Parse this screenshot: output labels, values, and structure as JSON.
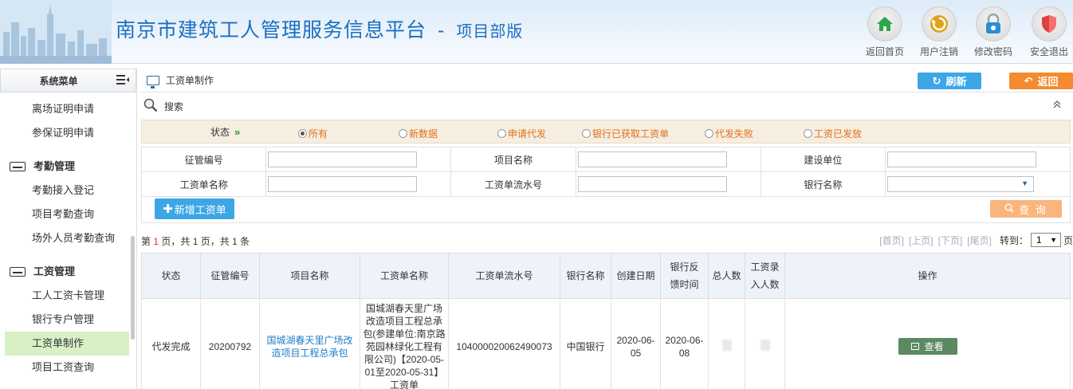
{
  "header": {
    "title": "南京市建筑工人管理服务信息平台",
    "separator": "-",
    "subtitle": "项目部版",
    "buttons": [
      {
        "label": "返回首页",
        "icon": "home-icon",
        "color": "#2aa84a"
      },
      {
        "label": "用户注销",
        "icon": "logout-icon",
        "color": "#e0a21a"
      },
      {
        "label": "修改密码",
        "icon": "lock-icon",
        "color": "#2a8ed6"
      },
      {
        "label": "安全退出",
        "icon": "shield-icon",
        "color": "#e04040"
      }
    ]
  },
  "sidebar": {
    "title": "系统菜单",
    "items_top": [
      "离场证明申请",
      "参保证明申请"
    ],
    "group1": {
      "title": "考勤管理",
      "items": [
        "考勤接入登记",
        "项目考勤查询",
        "场外人员考勤查询"
      ]
    },
    "group2": {
      "title": "工资管理",
      "items": [
        "工人工资卡管理",
        "银行专户管理",
        "工资单制作",
        "项目工资查询"
      ]
    },
    "active": "工资单制作"
  },
  "toolbar": {
    "page_title": "工资单制作",
    "refresh_label": "刷新",
    "back_label": "返回"
  },
  "search": {
    "label": "搜索",
    "status_label": "状态",
    "status_options": [
      "所有",
      "新数据",
      "申请代发",
      "银行已获取工资单",
      "代发失败",
      "工资已发放"
    ],
    "selected_status": "所有",
    "fields": {
      "f1": "征管编号",
      "f2": "项目名称",
      "f3": "建设单位",
      "f4": "工资单名称",
      "f5": "工资单流水号",
      "f6": "银行名称"
    },
    "add_label": "新增工资单",
    "query_label": "查 询"
  },
  "pager": {
    "prefix": "第",
    "page": "1",
    "mid1": "页，共",
    "pages": "1",
    "mid2": "页，共",
    "total": "1",
    "suffix": "条",
    "first": "[首页]",
    "prev": "[上页]",
    "next": "[下页]",
    "last": "[尾页]",
    "goto": "转到：",
    "goto_value": "1",
    "page_unit": "页"
  },
  "table": {
    "headers": {
      "status": "状态",
      "code": "征管编号",
      "project": "项目名称",
      "sheet": "工资单名称",
      "serial": "工资单流水号",
      "bank": "银行名称",
      "created": "创建日期",
      "feedback": "银行反馈时间",
      "total": "总人数",
      "entered": "工资录入人数",
      "ops": "操作"
    },
    "rows": [
      {
        "status": "代发完成",
        "code": "20200792",
        "project": "国城湖春天里广场改造项目工程总承包",
        "sheet": "国城湖春天里广场改造项目工程总承包(参建单位:南京路苑园林绿化工程有限公司)【2020-05-01至2020-05-31】工资单",
        "serial": "104000020062490073",
        "bank": "中国银行",
        "created": "2020-06-05",
        "feedback": "2020-06-08",
        "view_label": "查看"
      }
    ]
  }
}
